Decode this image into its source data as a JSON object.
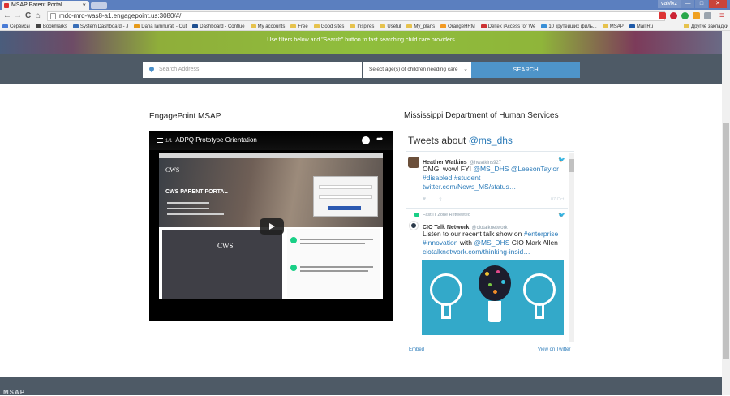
{
  "browser": {
    "tab_title": "MSAP Parent Portal",
    "tab_close": "×",
    "window_controls": [
      "vaMxz",
      "—",
      "□",
      "✕"
    ],
    "url": "mdc-mrq-was8-a1.engagepoint.us:3080/#/",
    "nav": {
      "back": "←",
      "forward": "→",
      "reload": "C",
      "home": "⌂",
      "star": "☆",
      "menu": "≡"
    },
    "bookmarks": [
      "Сервисы",
      "Bookmarks",
      "System Dashboard - J",
      "Daria Iamnurati - Out",
      "Dashboard - Conflue",
      "My accounts",
      "Free",
      "Good sites",
      "Inspires",
      "Useful",
      "My_plans",
      "OrangeHRM",
      "Deltek iAccess for We",
      "10 крутейших филь...",
      "MSAP",
      "Mail.Ru"
    ],
    "other_bookmarks": "Другие закладки"
  },
  "hero": {
    "text": "Use filters below and \"Search\" button to fast searching child care providers"
  },
  "search": {
    "address_placeholder": "Search Address",
    "age_select": "Select age(s) of children needing care",
    "button": "SEARCH"
  },
  "left": {
    "title": "EngagePoint MSAP",
    "video": {
      "counter": "1/1",
      "title": "ADPQ Prototype Orientation",
      "inner_logo": "CWS",
      "inner_portal": "CWS PARENT PORTAL",
      "inner_logo2": "CWS"
    }
  },
  "right": {
    "title": "Mississippi Department of Human Services",
    "tweets_label": "Tweets about ",
    "tweets_handle": "@ms_dhs",
    "tweets": [
      {
        "name": "Heather Watkins",
        "user": "@hwatkins927",
        "body_text": "OMG, wow! FYI ",
        "mention1": "@MS_DHS",
        "mention2": "@LeesonTaylor",
        "tag1": "#disabled",
        "tag2": "#student",
        "link": "twitter.com/News_MS/status…",
        "date": "07 Oct"
      },
      {
        "retweeted_by": "Fast IT Zone Retweeted",
        "name": "CIO Talk Network",
        "user": "@ciotalknetwork",
        "line1": "Listen to our recent talk show on ",
        "tag1": "#enterprise",
        "tag2": "#innovation",
        "line2_mid": " with ",
        "mention": "@MS_DHS",
        "line2_end": " CIO Mark Allen",
        "link": "ciotalknetwork.com/thinking-insid…"
      }
    ],
    "footer_embed": "Embed",
    "footer_view": "View on Twitter"
  },
  "footer": {
    "logo": "MSAP"
  },
  "colors": {
    "band": "#4e5a66",
    "search_button": "#4e94c9",
    "link": "#2b7bb9",
    "hero_green": "#8fbe3c"
  }
}
